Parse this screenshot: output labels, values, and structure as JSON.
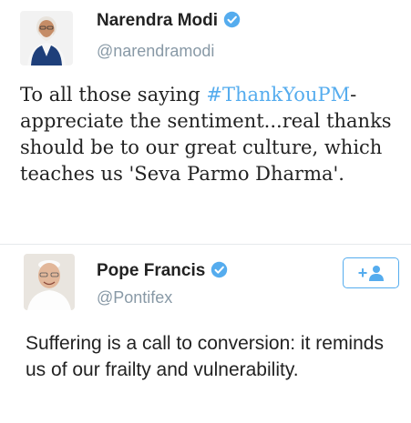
{
  "tweets": [
    {
      "author": {
        "name": "Narendra Modi",
        "handle": "@narendramodi",
        "verified": true
      },
      "text_before": "To all those saying ",
      "hashtag": "#ThankYouPM",
      "text_after": "- appreciate the sentiment...real thanks should be to our great culture, which teaches us 'Seva Parmo Dharma'."
    },
    {
      "author": {
        "name": "Pope Francis",
        "handle": "@Pontifex",
        "verified": true
      },
      "follow_button": {
        "plus": "+",
        "icon": "person-icon"
      },
      "text": "Suffering is a call to conversion: it reminds us of our frailty and vulnerability."
    }
  ],
  "colors": {
    "accent": "#55acee",
    "handle": "#8899a6",
    "text": "#222222",
    "divider": "#e6e9ec"
  }
}
